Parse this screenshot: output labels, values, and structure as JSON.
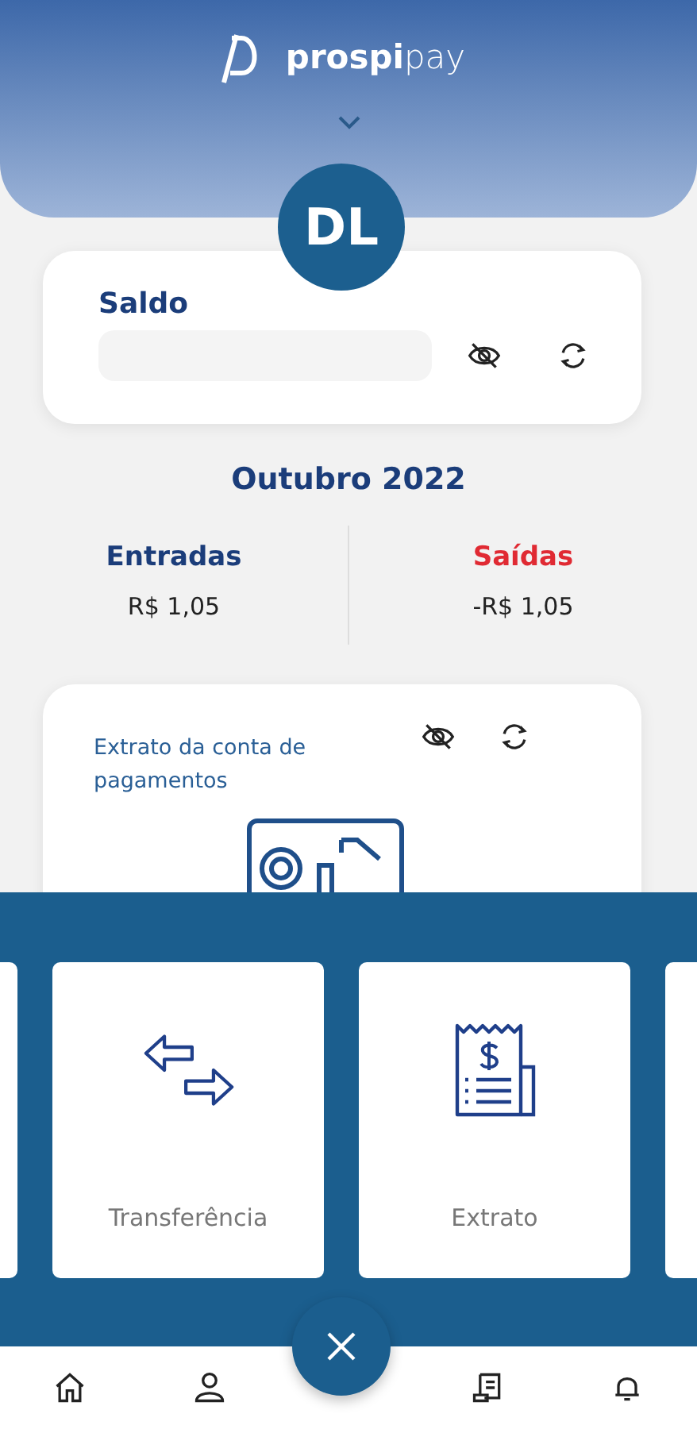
{
  "header": {
    "logo": "**prospi**pay"
  },
  "avatar": {
    "initials": "DL"
  },
  "balance_card": {
    "title": "Saldo"
  },
  "period": "Outubro 2022",
  "summary": [
    {
      "kind": "in",
      "label": "Entradas",
      "value": "R$ 1,05"
    },
    {
      "kind": "out",
      "label": "Saídas",
      "value": "-R$ 1,05"
    }
  ],
  "statement_card": {
    "title": "Extrato da conta de pagamentos"
  },
  "actions": [
    {
      "kind": "edge"
    },
    {
      "kind": "card",
      "label": "Transferência"
    },
    {
      "kind": "card",
      "label": "Extrato"
    },
    {
      "kind": "edge"
    }
  ]
}
